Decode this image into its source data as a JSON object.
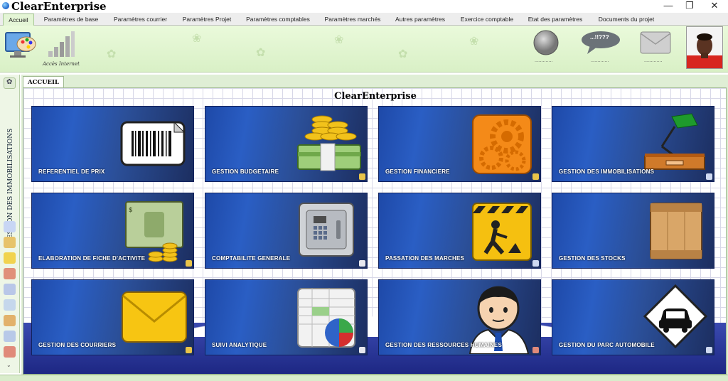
{
  "window": {
    "title": "ClearEnterprise",
    "controls": {
      "minimize": "—",
      "maximize": "❐",
      "close": "✕"
    }
  },
  "menu_tabs": [
    {
      "label": "Accueil",
      "active": true
    },
    {
      "label": "Paramètres de base"
    },
    {
      "label": "Paramètres courrier"
    },
    {
      "label": "Paramètres Projet"
    },
    {
      "label": "Paramètres comptables"
    },
    {
      "label": "Paramètres marchés"
    },
    {
      "label": "Autres paramètres"
    },
    {
      "label": "Exercice comptable"
    },
    {
      "label": "Etat des paramètres"
    },
    {
      "label": "Documents du projet"
    }
  ],
  "ribbon": {
    "internet_label": "Accès Internet",
    "chat_bubble_text": "...!!???",
    "status_dots": ".............",
    "message_dots": ".............",
    "mail_dots": ".............",
    "icons": [
      "paint-palette-icon",
      "signal-bars-icon",
      "status-circle-icon",
      "chat-bubble-icon",
      "envelope-icon",
      "user-photo"
    ]
  },
  "sidebar": {
    "vertical_label": "GESTION DES IMMOBILISATIONS",
    "buttons": [
      "flower-icon",
      "copy-icon",
      "user-icon",
      "group-icon",
      "chart-icon",
      "graph-icon",
      "line-chart-icon",
      "box-icon",
      "grid-icon",
      "person-icon"
    ]
  },
  "main": {
    "doc_tab": "ACCUEIL",
    "heading": "ClearEnterprise",
    "tiles": [
      {
        "label": "REFERENTIEL DE PRIX",
        "icon": "barcode-icon"
      },
      {
        "label": "GESTION BUDGETAIRE",
        "icon": "money-coins-icon"
      },
      {
        "label": "GESTION FINANCIERE",
        "icon": "gears-icon"
      },
      {
        "label": "GESTION DES IMMOBILISATIONS",
        "icon": "desk-lamp-icon"
      },
      {
        "label": "ELABORATION DE FICHE D'ACTIVITE",
        "icon": "banknote-icon"
      },
      {
        "label": "COMPTABILITE GENERALE",
        "icon": "safe-icon"
      },
      {
        "label": "PASSATION DES MARCHES",
        "icon": "construction-sign-icon"
      },
      {
        "label": "GESTION DES STOCKS",
        "icon": "wooden-crate-icon"
      },
      {
        "label": "GESTION DES COURRIERS",
        "icon": "envelope-icon"
      },
      {
        "label": "SUIVI ANALYTIQUE",
        "icon": "spreadsheet-pie-icon"
      },
      {
        "label": "GESTION DES RESSOURCES HUMAINES",
        "icon": "businessman-icon"
      },
      {
        "label": "GESTION DU PARC AUTOMOBILE",
        "icon": "car-sign-icon"
      }
    ]
  },
  "colors": {
    "ribbon_bg": "#e2f5d2",
    "tile_blue": "#2a5ec4",
    "tile_dark": "#1c2e60"
  }
}
